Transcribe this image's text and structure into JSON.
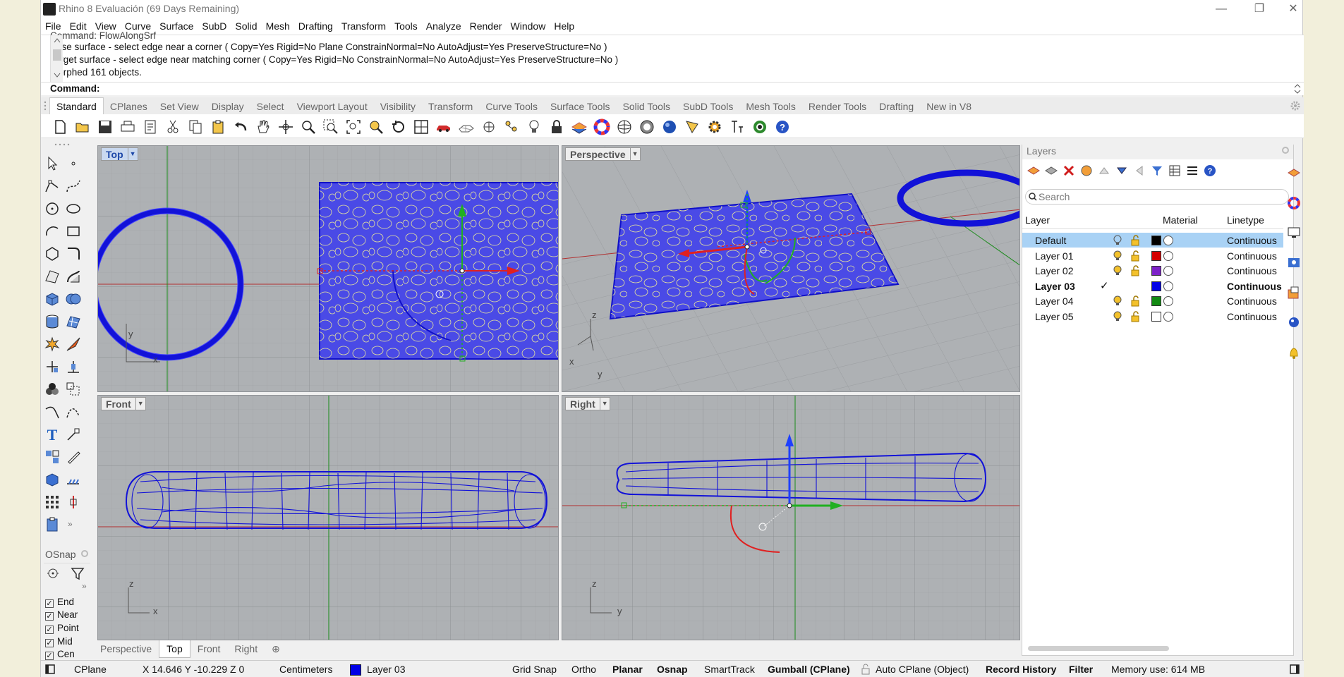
{
  "window": {
    "title": "Rhino 8 Evaluación (69 Days Remaining)",
    "minimize": "—",
    "maximize": "❐",
    "close": "✕"
  },
  "menu": [
    "File",
    "Edit",
    "View",
    "Curve",
    "Surface",
    "SubD",
    "Solid",
    "Mesh",
    "Drafting",
    "Transform",
    "Tools",
    "Analyze",
    "Render",
    "Window",
    "Help"
  ],
  "command_history": [
    "Command: FlowAlongSrf",
    "Base surface - select edge near a corner ( Copy=Yes  Rigid=No  Plane  ConstrainNormal=No  AutoAdjust=Yes  PreserveStructure=No )",
    "Target surface - select edge near matching corner ( Copy=Yes  Rigid=No  ConstrainNormal=No  AutoAdjust=Yes  PreserveStructure=No )",
    "Morphed 161 objects."
  ],
  "command_prompt": "Command:",
  "toolbar_tabs": [
    "Standard",
    "CPlanes",
    "Set View",
    "Display",
    "Select",
    "Viewport Layout",
    "Visibility",
    "Transform",
    "Curve Tools",
    "Surface Tools",
    "Solid Tools",
    "SubD Tools",
    "Mesh Tools",
    "Render Tools",
    "Drafting",
    "New in V8"
  ],
  "active_tab": "Standard",
  "viewports": {
    "top": "Top",
    "perspective": "Perspective",
    "front": "Front",
    "right": "Right"
  },
  "viewport_tabs": [
    "Perspective",
    "Top",
    "Front",
    "Right"
  ],
  "active_viewport_tab": "Top",
  "axes": {
    "top": [
      "y",
      "x"
    ],
    "perspective": [
      "z",
      "x",
      "y"
    ],
    "front": [
      "z",
      "x"
    ],
    "right": [
      "z",
      "y"
    ]
  },
  "osnap": {
    "title": "OSnap",
    "more": "»",
    "items": [
      {
        "label": "End",
        "checked": true
      },
      {
        "label": "Near",
        "checked": true
      },
      {
        "label": "Point",
        "checked": true
      },
      {
        "label": "Mid",
        "checked": true
      },
      {
        "label": "Cen",
        "checked": true
      }
    ]
  },
  "layers": {
    "title": "Layers",
    "search_placeholder": "Search",
    "columns": {
      "layer": "Layer",
      "material": "Material",
      "linetype": "Linetype"
    },
    "rows": [
      {
        "name": "Default",
        "color": "#000000",
        "linetype": "Continuous",
        "selected": true,
        "current": false
      },
      {
        "name": "Layer 01",
        "color": "#d40000",
        "linetype": "Continuous",
        "selected": false,
        "current": false
      },
      {
        "name": "Layer 02",
        "color": "#7d22c8",
        "linetype": "Continuous",
        "selected": false,
        "current": false
      },
      {
        "name": "Layer 03",
        "color": "#0000e6",
        "linetype": "Continuous",
        "selected": false,
        "current": true,
        "check": "✓"
      },
      {
        "name": "Layer 04",
        "color": "#128a12",
        "linetype": "Continuous",
        "selected": false,
        "current": false
      },
      {
        "name": "Layer 05",
        "color": "#ffffff",
        "linetype": "Continuous",
        "selected": false,
        "current": false
      }
    ]
  },
  "status": {
    "cplane": "CPlane",
    "coords": "X 14.646 Y -10.229 Z 0",
    "units": "Centimeters",
    "layer": "Layer 03",
    "layer_color": "#0000e6",
    "grid_snap": "Grid Snap",
    "ortho": "Ortho",
    "planar": "Planar",
    "osnap": "Osnap",
    "smarttrack": "SmartTrack",
    "gumball": "Gumball (CPlane)",
    "autocplane": "Auto CPlane (Object)",
    "record_history": "Record History",
    "filter": "Filter",
    "memory": "Memory use: 614 MB"
  },
  "colors": {
    "object": "#1010e0",
    "selected": "#4d4df0",
    "grid": "#9a9da0",
    "red_axis": "#c02020",
    "green_axis": "#1a9a1a"
  }
}
